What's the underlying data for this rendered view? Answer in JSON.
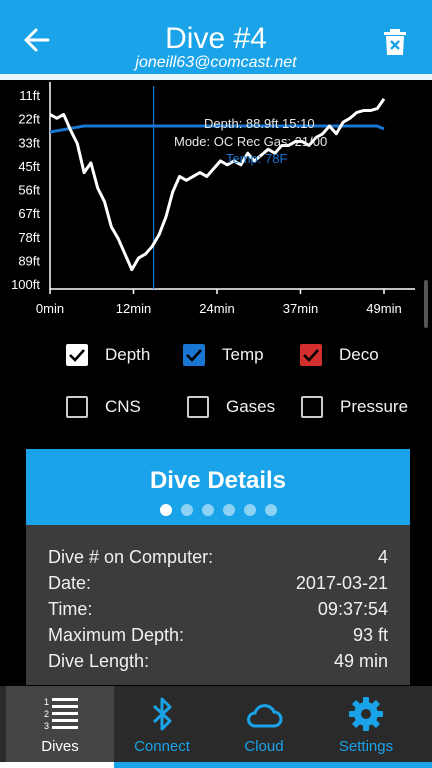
{
  "header": {
    "title": "Dive #4",
    "subtitle": "joneill63@comcast.net"
  },
  "chart": {
    "y_labels": [
      "11ft",
      "22ft",
      "33ft",
      "45ft",
      "56ft",
      "67ft",
      "78ft",
      "89ft",
      "100ft"
    ],
    "x_labels": [
      "0min",
      "12min",
      "24min",
      "37min",
      "49min"
    ],
    "tooltip": {
      "line1": "Depth: 88.9ft   15:10",
      "line2": "Mode: OC Rec Gas: 21/00",
      "line3": "Temp: 78F"
    }
  },
  "chart_data": {
    "type": "line",
    "x": [
      0,
      1,
      2,
      3,
      4,
      5,
      6,
      7,
      8,
      9,
      10,
      11,
      12,
      13,
      14,
      15,
      16,
      17,
      18,
      19,
      20,
      21,
      22,
      23,
      24,
      25,
      26,
      27,
      28,
      29,
      30,
      31,
      32,
      33,
      34,
      35,
      36,
      37,
      38,
      39,
      40,
      41,
      42,
      43,
      44,
      45,
      46,
      47,
      48,
      49
    ],
    "series": [
      {
        "name": "Depth",
        "values": [
          10,
          12,
          10,
          18,
          25,
          40,
          35,
          48,
          55,
          68,
          74,
          82,
          90,
          84,
          82,
          78,
          72,
          63,
          50,
          42,
          44,
          42,
          40,
          42,
          38,
          34,
          36,
          34,
          36,
          30,
          34,
          31,
          28,
          30,
          26,
          26,
          24,
          24,
          26,
          22,
          20,
          16,
          20,
          14,
          12,
          9,
          8,
          8,
          7,
          2
        ]
      },
      {
        "name": "Temp",
        "values": [
          77,
          77.2,
          77.4,
          77.6,
          77.8,
          78,
          78,
          78,
          78,
          78,
          78,
          78,
          78,
          78,
          78,
          78,
          78,
          78,
          78,
          78,
          78,
          78,
          78,
          78,
          78,
          78,
          78,
          78,
          78,
          78,
          78,
          78,
          78,
          78,
          78,
          78,
          78,
          78,
          78,
          78,
          78,
          78,
          78,
          78,
          78,
          78,
          78,
          78,
          78,
          77.5
        ]
      }
    ],
    "xlabel": "",
    "ylabel": "",
    "x_range": [
      0,
      49
    ],
    "y_range": [
      0,
      100
    ],
    "y_inverted": true,
    "cursor_x": 15.2,
    "grid": false,
    "colors": {
      "Depth": "#ffffff",
      "Temp": "#1976d2",
      "cursor": "#1976d2"
    }
  },
  "checkboxes": [
    {
      "label": "Depth",
      "checked": true,
      "color": "white"
    },
    {
      "label": "Temp",
      "checked": true,
      "color": "blue"
    },
    {
      "label": "Deco",
      "checked": true,
      "color": "red"
    },
    {
      "label": "CNS",
      "checked": false
    },
    {
      "label": "Gases",
      "checked": false
    },
    {
      "label": "Pressure",
      "checked": false
    }
  ],
  "details": {
    "title": "Dive Details",
    "page_count": 6,
    "active_page": 1,
    "rows": [
      {
        "label": "Dive # on Computer:",
        "value": "4"
      },
      {
        "label": "Date:",
        "value": "2017-03-21"
      },
      {
        "label": "Time:",
        "value": "09:37:54"
      },
      {
        "label": "Maximum Depth:",
        "value": "93 ft"
      },
      {
        "label": "Dive Length:",
        "value": "49 min"
      }
    ]
  },
  "nav": {
    "items": [
      {
        "label": "Dives",
        "icon": "list-numbered-icon",
        "active": true
      },
      {
        "label": "Connect",
        "icon": "bluetooth-icon",
        "active": false
      },
      {
        "label": "Cloud",
        "icon": "cloud-icon",
        "active": false
      },
      {
        "label": "Settings",
        "icon": "gear-icon",
        "active": false
      }
    ]
  },
  "colors": {
    "accent": "#1aa3e8",
    "background": "#000000",
    "card_body": "#3c3c3c"
  }
}
